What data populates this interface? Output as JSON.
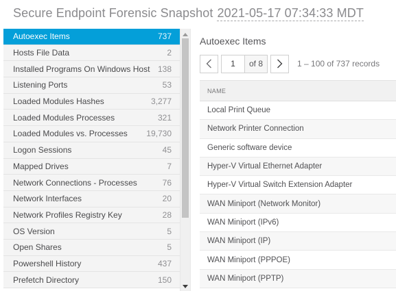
{
  "header": {
    "title": "Secure Endpoint Forensic Snapshot",
    "timestamp": "2021-05-17 07:34:33 MDT"
  },
  "categories": [
    {
      "label": "Autoexec Items",
      "count": "737",
      "selected": true
    },
    {
      "label": "Hosts File Data",
      "count": "2"
    },
    {
      "label": "Installed Programs On Windows Host",
      "count": "138"
    },
    {
      "label": "Listening Ports",
      "count": "53"
    },
    {
      "label": "Loaded Modules Hashes",
      "count": "3,277"
    },
    {
      "label": "Loaded Modules Processes",
      "count": "321"
    },
    {
      "label": "Loaded Modules vs. Processes",
      "count": "19,730"
    },
    {
      "label": "Logon Sessions",
      "count": "45"
    },
    {
      "label": "Mapped Drives",
      "count": "7"
    },
    {
      "label": "Network Connections - Processes",
      "count": "76"
    },
    {
      "label": "Network Interfaces",
      "count": "20"
    },
    {
      "label": "Network Profiles Registry Key",
      "count": "28"
    },
    {
      "label": "OS Version",
      "count": "5"
    },
    {
      "label": "Open Shares",
      "count": "5"
    },
    {
      "label": "Powershell History",
      "count": "437"
    },
    {
      "label": "Prefetch Directory",
      "count": "150"
    }
  ],
  "panel": {
    "title": "Autoexec Items",
    "pager": {
      "page": "1",
      "of_label": "of 8",
      "range_text": "1 – 100 of 737 records"
    },
    "table": {
      "column": "NAME",
      "rows": [
        "Local Print Queue",
        "Network Printer Connection",
        "Generic software device",
        "Hyper-V Virtual Ethernet Adapter",
        "Hyper-V Virtual Switch Extension Adapter",
        "WAN Miniport (Network Monitor)",
        "WAN Miniport (IPv6)",
        "WAN Miniport (IP)",
        "WAN Miniport (PPPOE)",
        "WAN Miniport (PPTP)"
      ]
    }
  },
  "colors": {
    "selected": "#049fd9",
    "sidebar_bg": "#f4f4f4"
  },
  "icons": {
    "prev": "chevron-left-icon",
    "next": "chevron-right-icon",
    "scroll_up": "triangle-up-icon",
    "scroll_down": "triangle-down-icon"
  }
}
